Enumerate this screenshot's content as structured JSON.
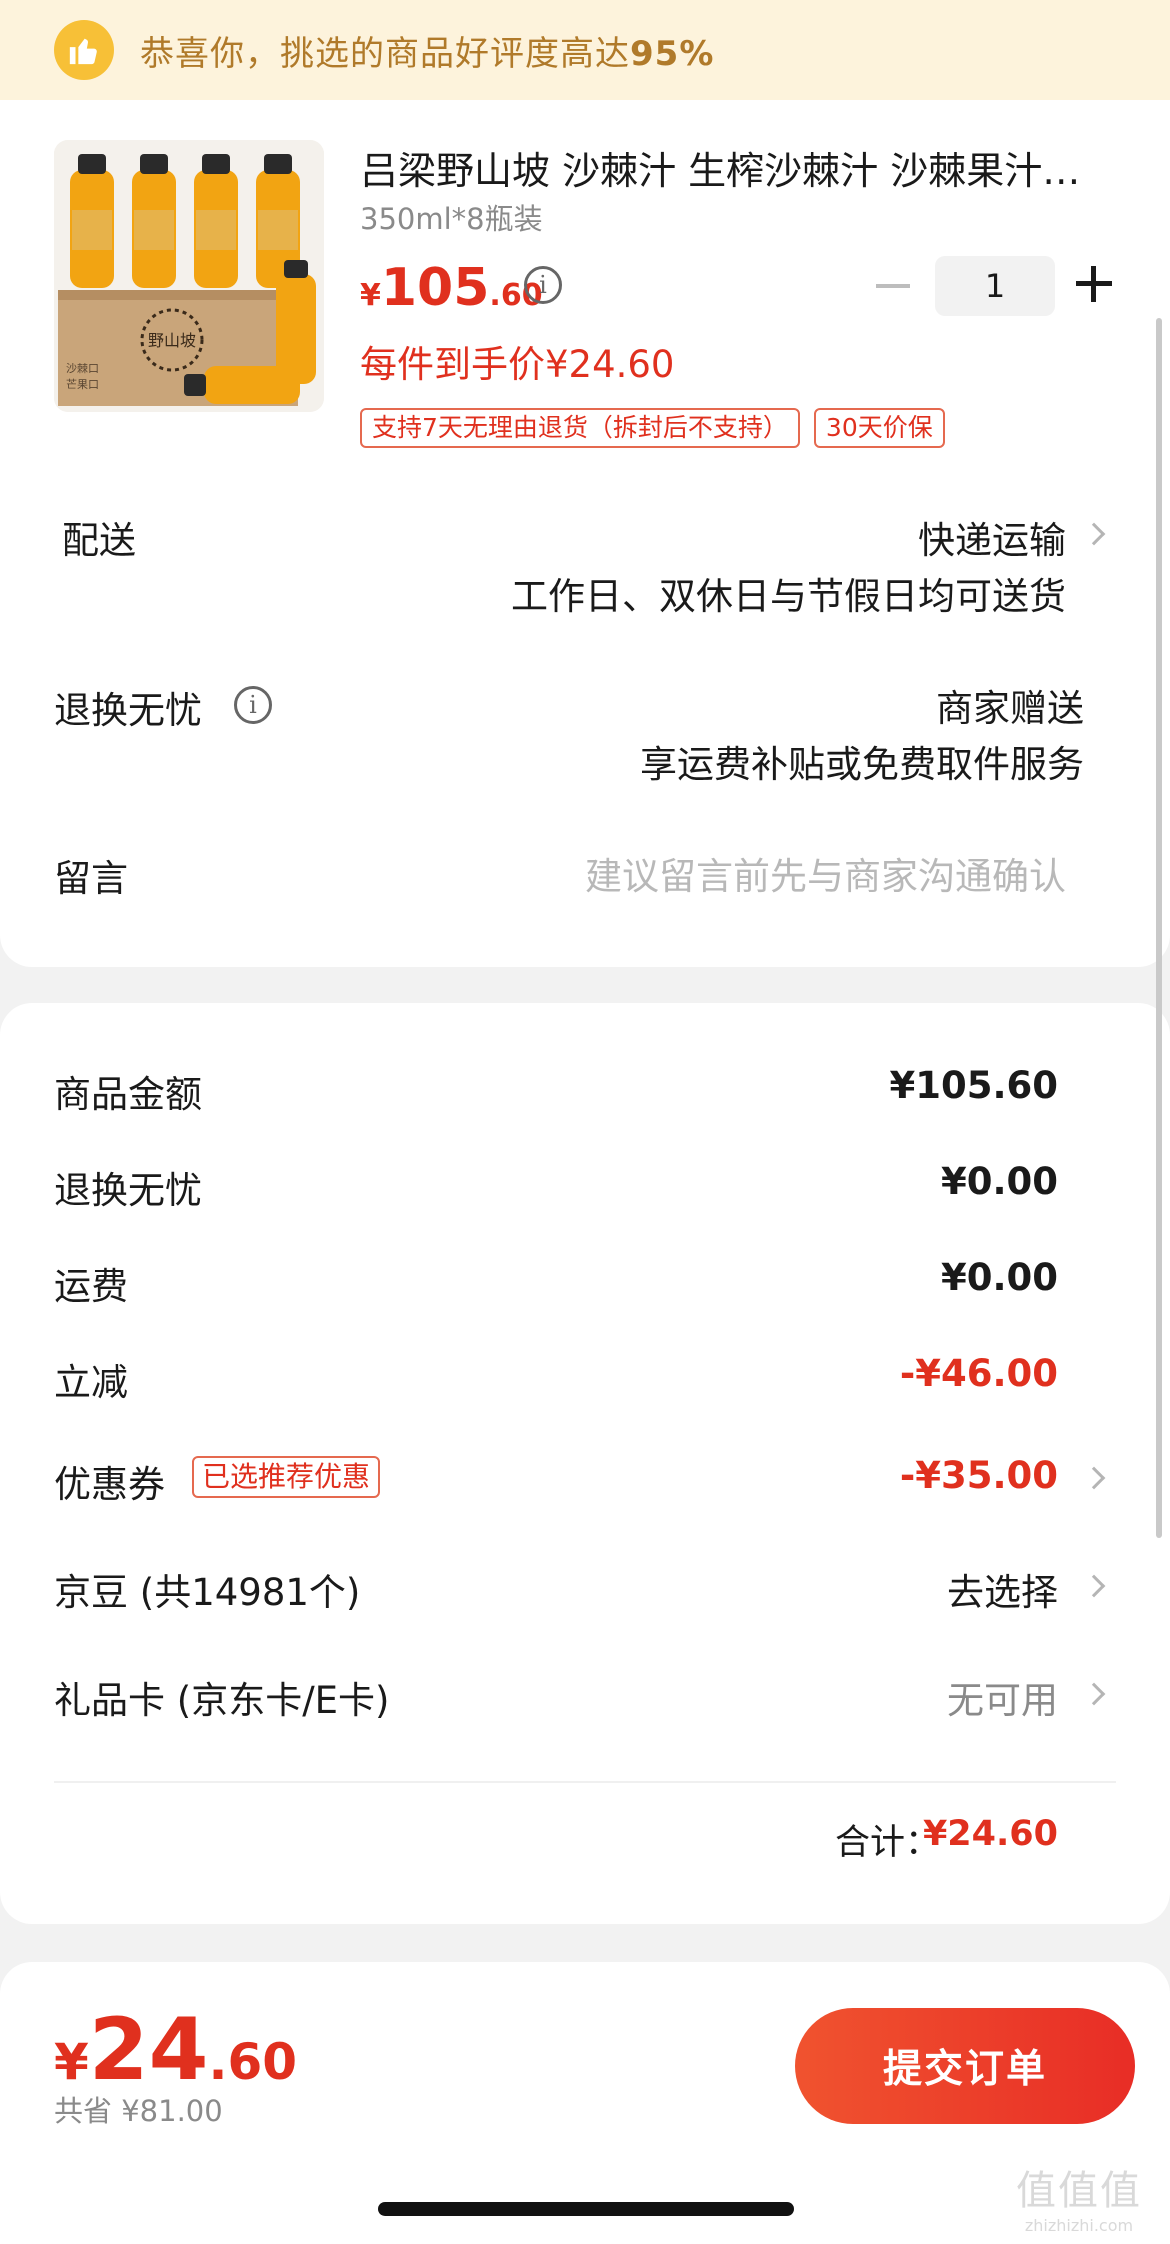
{
  "banner": {
    "text": "恭喜你，挑选的商品好评度高达",
    "highlight": "95%",
    "icon": "thumbs-up-icon"
  },
  "product": {
    "title": "吕梁野山坡 沙棘汁 生榨沙棘汁 沙棘果汁…",
    "spec": "350ml*8瓶装",
    "price_symbol": "¥",
    "price_int": "105",
    "price_dec": ".60",
    "unit_price": "每件到手价¥24.60",
    "tags": [
      "支持7天无理由退货（拆封后不支持）",
      "30天价保"
    ],
    "quantity": "1",
    "image_box_text": "野山坡",
    "image_box_sub1": "沙棘口",
    "image_box_sub2": "芒果口"
  },
  "delivery": {
    "label": "配送",
    "method": "快递运输",
    "note": "工作日、双休日与节假日均可送货"
  },
  "worry_free": {
    "label": "退换无忧",
    "value": "商家赠送",
    "note": "享运费补贴或免费取件服务"
  },
  "message": {
    "label": "留言",
    "placeholder": "建议留言前先与商家沟通确认"
  },
  "fees": {
    "goods_amount": {
      "label": "商品金额",
      "value": "¥105.60"
    },
    "worry_free": {
      "label": "退换无忧",
      "value": "¥0.00"
    },
    "shipping": {
      "label": "运费",
      "value": "¥0.00"
    },
    "instant_discount": {
      "label": "立减",
      "value": "-¥46.00"
    },
    "coupon": {
      "label": "优惠券",
      "tag": "已选推荐优惠",
      "value": "-¥35.00"
    },
    "jd_beans": {
      "label": "京豆 (共14981个)",
      "value": "去选择"
    },
    "gift_card": {
      "label": "礼品卡 (京东卡/E卡)",
      "value": "无可用"
    },
    "total_label": "合计：",
    "total_value": "¥24.60"
  },
  "footer": {
    "price_symbol": "¥",
    "price_int": "24",
    "price_dec": ".60",
    "saved": "共省 ¥81.00",
    "submit": "提交订单"
  },
  "watermark": {
    "glyph": "值值值",
    "url": "zhizhizhi.com"
  },
  "colors": {
    "accent": "#e0301e",
    "banner_bg": "#fdf3dc",
    "banner_text": "#b07a2a"
  }
}
